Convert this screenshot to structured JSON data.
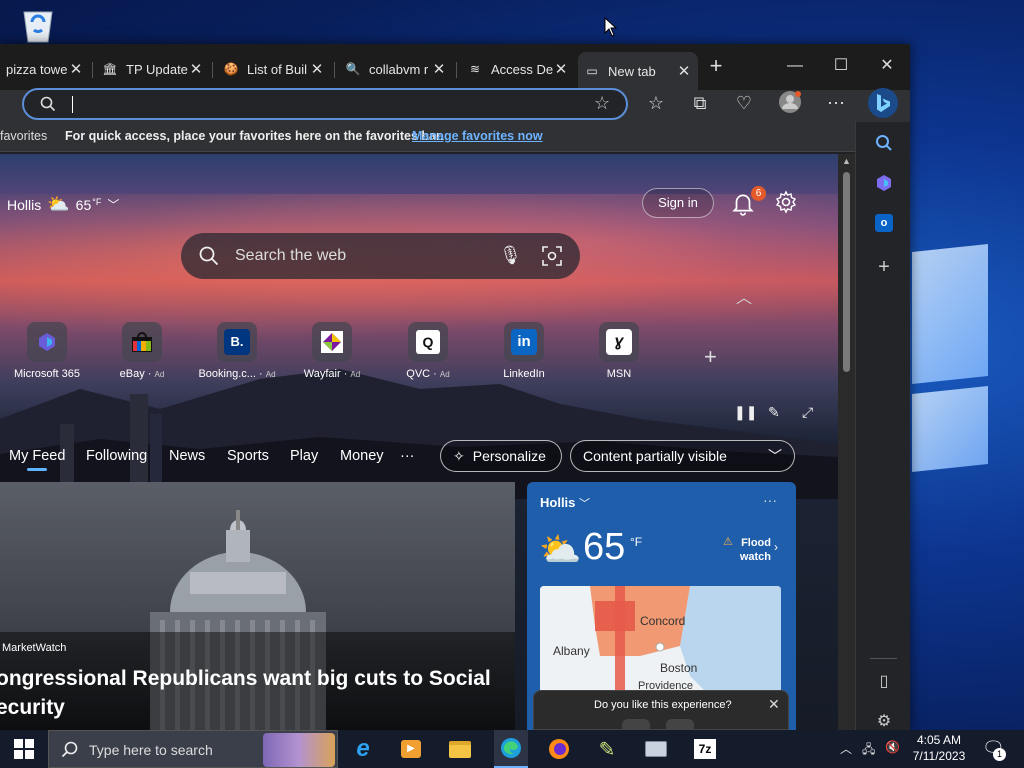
{
  "desktop": {
    "recycle_bin_icon": "recycle-bin-icon"
  },
  "tabs": [
    {
      "title": "pizza towe",
      "icon": "pizza-icon"
    },
    {
      "title": "TP Update",
      "icon": "building-icon"
    },
    {
      "title": "List of Buil",
      "icon": "cookie-icon"
    },
    {
      "title": "collabvm r",
      "icon": "search-icon"
    },
    {
      "title": "Access De",
      "icon": "stack-icon"
    },
    {
      "title": "New tab",
      "icon": "newtab-icon"
    }
  ],
  "address_bar": {
    "value": "",
    "placeholder": ""
  },
  "favorites_bar": {
    "label": "favorites",
    "message": "For quick access, place your favorites here on the favorites bar.",
    "link": "Manage favorites now"
  },
  "newtab": {
    "weather_location": "Hollis",
    "weather_temp": "65",
    "weather_unit": "°F",
    "sign_in": "Sign in",
    "notification_count": "6",
    "search_placeholder": "Search the web",
    "quick_links": [
      {
        "label": "Microsoft 365",
        "ad": ""
      },
      {
        "label": "eBay",
        "ad": "Ad"
      },
      {
        "label": "Booking.c...",
        "ad": "Ad"
      },
      {
        "label": "Wayfair",
        "ad": "Ad"
      },
      {
        "label": "QVC",
        "ad": "Ad"
      },
      {
        "label": "LinkedIn",
        "ad": ""
      },
      {
        "label": "MSN",
        "ad": ""
      }
    ],
    "feed_tabs": [
      "My Feed",
      "Following",
      "News",
      "Sports",
      "Play",
      "Money",
      "···"
    ],
    "personalize": "Personalize",
    "content_visibility": "Content partially visible"
  },
  "news_card": {
    "source": "MarketWatch",
    "headline": "ongressional Republicans want big cuts to Social ecurity"
  },
  "weather_card": {
    "location": "Hollis",
    "temp": "65",
    "unit": "°F",
    "alert": "Flood watch",
    "map_labels": [
      "Concord",
      "Albany",
      "Boston",
      "Providence"
    ]
  },
  "feedback": {
    "question": "Do you like this experience?"
  },
  "taskbar": {
    "search_placeholder": "Type here to search",
    "time": "4:05 AM",
    "date": "7/11/2023",
    "notification_count": "1"
  },
  "colors": {
    "accent": "#5fb3ff",
    "address_border": "#5b8fd9",
    "weather_card": "#1e5eaa",
    "badge": "#e45a2a"
  }
}
